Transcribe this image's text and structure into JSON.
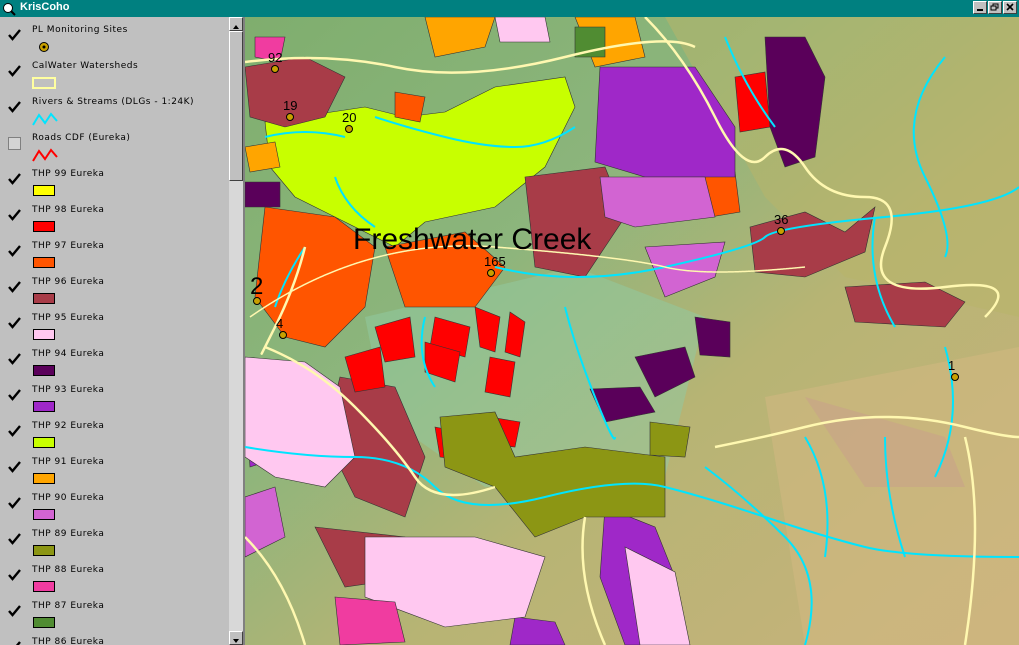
{
  "window": {
    "title": "KrisCoho",
    "buttons": [
      "minimize",
      "restore",
      "close"
    ]
  },
  "legend": {
    "layers": [
      {
        "label": "PL Monitoring Sites",
        "checked": true,
        "symbol": "point",
        "color": "#c8a000"
      },
      {
        "label": "CalWater Watersheds",
        "checked": true,
        "symbol": "outline",
        "color": "#ffffa0"
      },
      {
        "label": "Rivers & Streams (DLGs - 1:24K)",
        "checked": true,
        "symbol": "line",
        "color": "#00e5ff"
      },
      {
        "label": "Roads CDF (Eureka)",
        "checked": false,
        "symbol": "line",
        "color": "#ff0000"
      },
      {
        "label": "THP 99 Eureka",
        "checked": true,
        "symbol": "fill",
        "color": "#ffff00"
      },
      {
        "label": "THP 98 Eureka",
        "checked": true,
        "symbol": "fill",
        "color": "#ff0000"
      },
      {
        "label": "THP 97 Eureka",
        "checked": true,
        "symbol": "fill",
        "color": "#ff5500"
      },
      {
        "label": "THP 96 Eureka",
        "checked": true,
        "symbol": "fill",
        "color": "#a83c48"
      },
      {
        "label": "THP 95 Eureka",
        "checked": true,
        "symbol": "fill",
        "color": "#ffc8f0"
      },
      {
        "label": "THP 94 Eureka",
        "checked": true,
        "symbol": "fill",
        "color": "#5a005a"
      },
      {
        "label": "THP 93 Eureka",
        "checked": true,
        "symbol": "fill",
        "color": "#9f28c8"
      },
      {
        "label": "THP 92 Eureka",
        "checked": true,
        "symbol": "fill",
        "color": "#c8ff00"
      },
      {
        "label": "THP 91 Eureka",
        "checked": true,
        "symbol": "fill",
        "color": "#ffa500"
      },
      {
        "label": "THP 90 Eureka",
        "checked": true,
        "symbol": "fill",
        "color": "#d264d2"
      },
      {
        "label": "THP 89 Eureka",
        "checked": true,
        "symbol": "fill",
        "color": "#8c9614"
      },
      {
        "label": "THP 88 Eureka",
        "checked": true,
        "symbol": "fill",
        "color": "#f03ca0"
      },
      {
        "label": "THP 87 Eureka",
        "checked": true,
        "symbol": "fill",
        "color": "#508c32"
      },
      {
        "label": "THP 86 Eureka",
        "checked": true,
        "symbol": "fill",
        "color": "#808080"
      }
    ]
  },
  "map": {
    "watershed_name": "Freshwater Creek",
    "site_labels": [
      "92",
      "19",
      "20",
      "36",
      "165",
      "2",
      "4",
      "1"
    ]
  }
}
